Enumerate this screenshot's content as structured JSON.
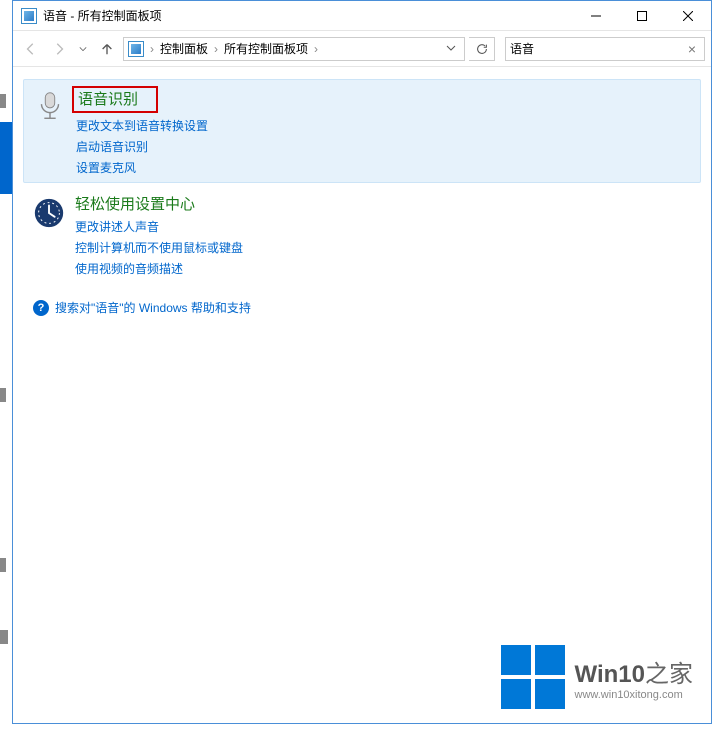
{
  "titlebar": {
    "title": "语音 - 所有控制面板项"
  },
  "breadcrumb": {
    "item1": "控制面板",
    "item2": "所有控制面板项"
  },
  "search": {
    "value": "语音"
  },
  "results": [
    {
      "title": "语音识别",
      "links": [
        "更改文本到语音转换设置",
        "启动语音识别",
        "设置麦克风"
      ]
    },
    {
      "title": "轻松使用设置中心",
      "links": [
        "更改讲述人声音",
        "控制计算机而不使用鼠标或键盘",
        "使用视频的音频描述"
      ]
    }
  ],
  "help": {
    "text": "搜索对\"语音\"的 Windows 帮助和支持"
  },
  "watermark": {
    "brand_prefix": "Win10",
    "brand_suffix": "之家",
    "url": "www.win10xitong.com"
  }
}
